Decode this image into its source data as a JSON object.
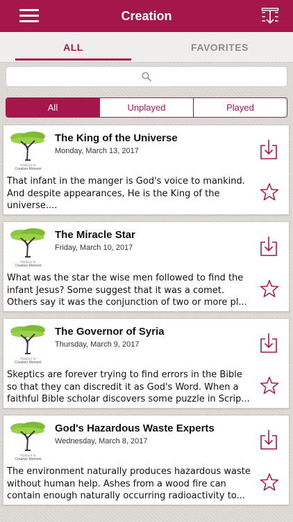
{
  "header": {
    "title": "Creation",
    "menu_icon": "hamburger-menu-icon",
    "sort_icon": "sort-download-icon"
  },
  "tabs": [
    {
      "label": "ALL",
      "active": true
    },
    {
      "label": "FAVORITES",
      "active": false
    }
  ],
  "search": {
    "placeholder": "",
    "icon": "search-icon"
  },
  "filter": [
    {
      "label": "All",
      "active": true
    },
    {
      "label": "Unplayed",
      "active": false
    },
    {
      "label": "Played",
      "active": false
    }
  ],
  "thumbnail": {
    "line1": "TODAY'S",
    "line2": "Creation Moment"
  },
  "episodes": [
    {
      "title": "The King of the Universe",
      "date": "Monday, March 13, 2017",
      "description": "That infant in the manger is God's voice to mankind. And despite appearances, He is the King of the universe...."
    },
    {
      "title": "The Miracle Star",
      "date": "Friday, March 10, 2017",
      "description": "What was the star the wise men followed to find the infant Jesus? Some suggest that it was a comet. Others say it was the conjunction of two or more pl..."
    },
    {
      "title": "The Governor of Syria",
      "date": "Thursday, March 9, 2017",
      "description": "Skeptics are forever trying to find errors in the Bible so that they can discredit it as God's Word. When a faithful Bible scholar discovers some puzzle in Scrip..."
    },
    {
      "title": "God's Hazardous Waste Experts",
      "date": "Wednesday, March 8, 2017",
      "description": "The environment naturally produces hazardous waste without human help. Ashes from a wood fire can contain enough naturally occurring radioactivity to..."
    }
  ],
  "colors": {
    "accent": "#a5174a",
    "background": "#dddad6"
  }
}
